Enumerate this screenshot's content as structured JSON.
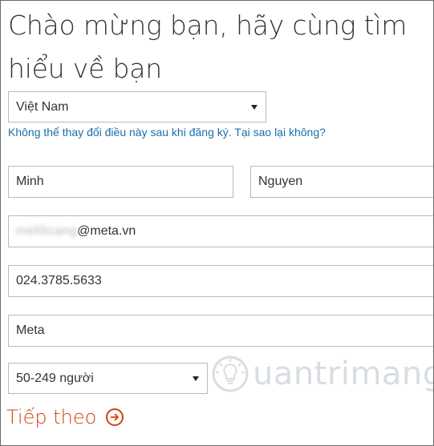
{
  "heading": "Chào mừng bạn, hãy cùng tìm hiểu về bạn",
  "country": {
    "selected": "Việt Nam"
  },
  "helper_text": "Không thể thay đổi điều này sau khi đăng ký. Tại sao lại không?",
  "first_name": {
    "value": "Minh"
  },
  "last_name": {
    "value": "Nguyen"
  },
  "email": {
    "masked_prefix": "melilicang",
    "domain": "@meta.vn"
  },
  "phone": {
    "value": "024.3785.5633"
  },
  "company": {
    "value": "Meta"
  },
  "company_size": {
    "selected": "50-249 người"
  },
  "next_button": {
    "label": "Tiếp theo",
    "icon": "arrow-right-circle-icon"
  },
  "watermark": {
    "text": "uantrimang"
  },
  "colors": {
    "accent": "#d4400c",
    "link": "#1a6fa8",
    "border": "#b9b9b9"
  }
}
